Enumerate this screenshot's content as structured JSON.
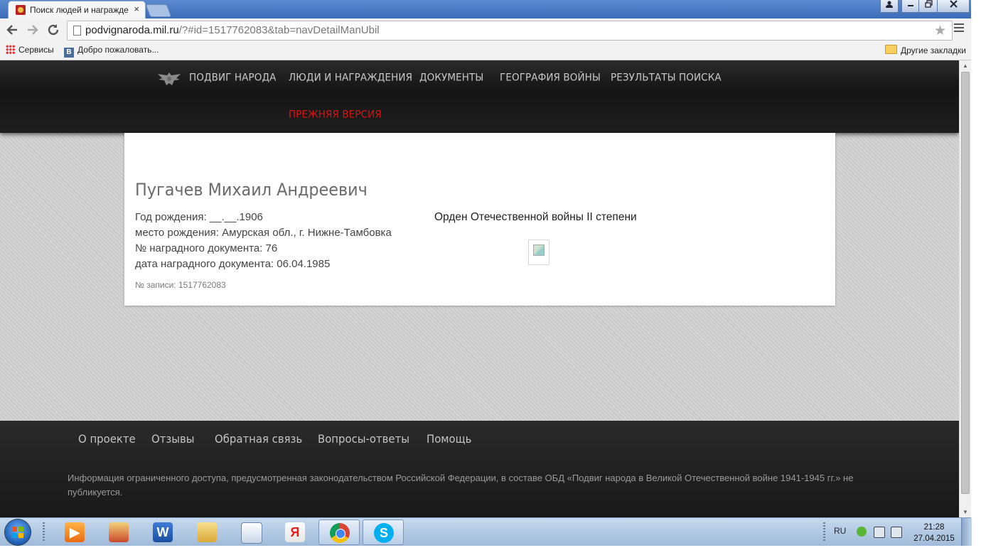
{
  "browser": {
    "tab_title": "Поиск людей и награжде",
    "tab_close": "×",
    "url_host": "podvignaroda.mil.ru",
    "url_rest": "/?#id=1517762083&tab=navDetailManUbil",
    "star": "★",
    "window_buttons": [
      "⁠▲",
      "—",
      "❐",
      "✕"
    ],
    "bookmarks": {
      "apps_label": "Сервисы",
      "welcome_label": "Добро пожаловать...",
      "vk_letter": "B",
      "other_label": "Другие закладки"
    }
  },
  "site_nav": {
    "brand": "ПОДВИГ НАРОДА",
    "people": "ЛЮДИ И НАГРАЖДЕНИЯ",
    "documents": "ДОКУМЕНТЫ",
    "geography": "ГЕОГРАФИЯ ВОЙНЫ",
    "results": "РЕЗУЛЬТАТЫ ПОИСКА",
    "old_version": "ПРЕЖНЯЯ ВЕРСИЯ"
  },
  "person": {
    "name": "Пугачев Михаил Андреевич",
    "birth_year": "Год рождения: __.__.1906",
    "birth_place": "место рождения: Амурская обл., г. Нижне-Тамбовка",
    "award_doc_number": "№ наградного документа: 76",
    "award_doc_date": "дата наградного документа: 06.04.1985",
    "record_id": "№ записи: 1517762083"
  },
  "award": {
    "title": "Орден Отечественной войны II степени"
  },
  "footer": {
    "links": [
      "О проекте",
      "Отзывы",
      "Обратная связь",
      "Вопросы-ответы",
      "Помощь"
    ],
    "note": "Информация ограниченного доступа, предусмотренная законодательством Российской Федерации, в составе ОБД «Подвиг народа в Великой Отечественной войне 1941-1945 гг.» не публикуется."
  },
  "taskbar": {
    "lang": "RU",
    "time": "21:28",
    "date": "27.04.2015",
    "word_letter": "W",
    "yandex_letter": "Я",
    "skype_letter": "S"
  },
  "colors": {
    "header_bg": "#1e1e1e",
    "nav_text": "#c8c8c8",
    "old_version": "#d81414",
    "page_bg": "#d2d2d2"
  }
}
